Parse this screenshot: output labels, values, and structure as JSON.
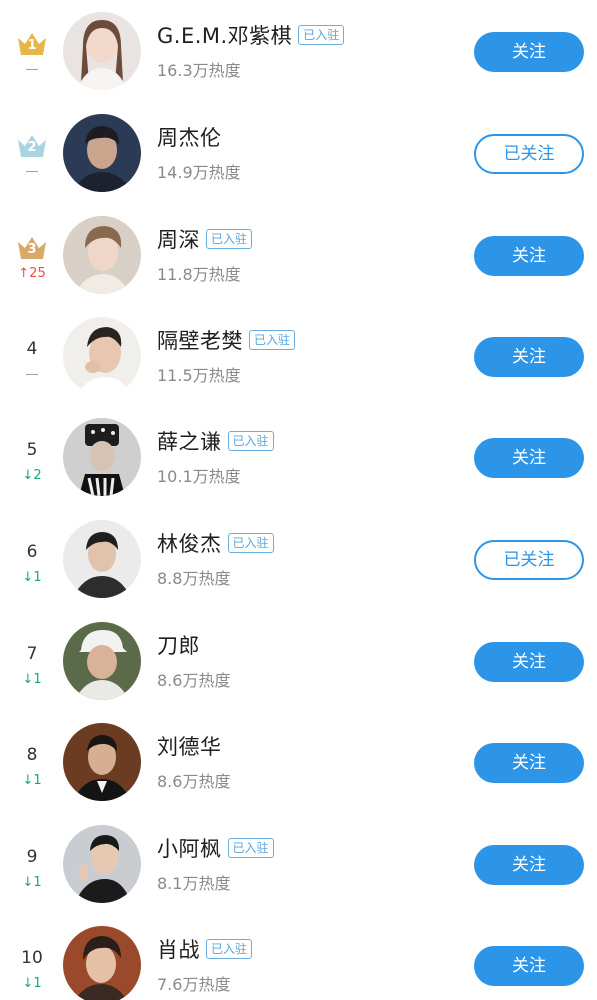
{
  "colors": {
    "accent": "#2d95e8",
    "gold": "#e8b548",
    "silver": "#a9d4e2",
    "bronze": "#d9a96a",
    "up": "#f04b4b",
    "down": "#1aa87a"
  },
  "rows": [
    {
      "rank": "1",
      "change": "—",
      "name": "G.E.M.邓紫棋",
      "badge": "已入驻",
      "heat": "16.3万热度",
      "button": "关注"
    },
    {
      "rank": "2",
      "change": "—",
      "name": "周杰伦",
      "badge": "",
      "heat": "14.9万热度",
      "button": "已关注"
    },
    {
      "rank": "3",
      "change": "25",
      "name": "周深",
      "badge": "已入驻",
      "heat": "11.8万热度",
      "button": "关注"
    },
    {
      "rank": "4",
      "change": "—",
      "name": "隔壁老樊",
      "badge": "已入驻",
      "heat": "11.5万热度",
      "button": "关注"
    },
    {
      "rank": "5",
      "change": "2",
      "name": "薛之谦",
      "badge": "已入驻",
      "heat": "10.1万热度",
      "button": "关注"
    },
    {
      "rank": "6",
      "change": "1",
      "name": "林俊杰",
      "badge": "已入驻",
      "heat": "8.8万热度",
      "button": "已关注"
    },
    {
      "rank": "7",
      "change": "1",
      "name": "刀郎",
      "badge": "",
      "heat": "8.6万热度",
      "button": "关注"
    },
    {
      "rank": "8",
      "change": "1",
      "name": "刘德华",
      "badge": "",
      "heat": "8.6万热度",
      "button": "关注"
    },
    {
      "rank": "9",
      "change": "1",
      "name": "小阿枫",
      "badge": "已入驻",
      "heat": "8.1万热度",
      "button": "关注"
    },
    {
      "rank": "10",
      "change": "1",
      "name": "肖战",
      "badge": "已入驻",
      "heat": "7.6万热度",
      "button": "关注"
    }
  ]
}
